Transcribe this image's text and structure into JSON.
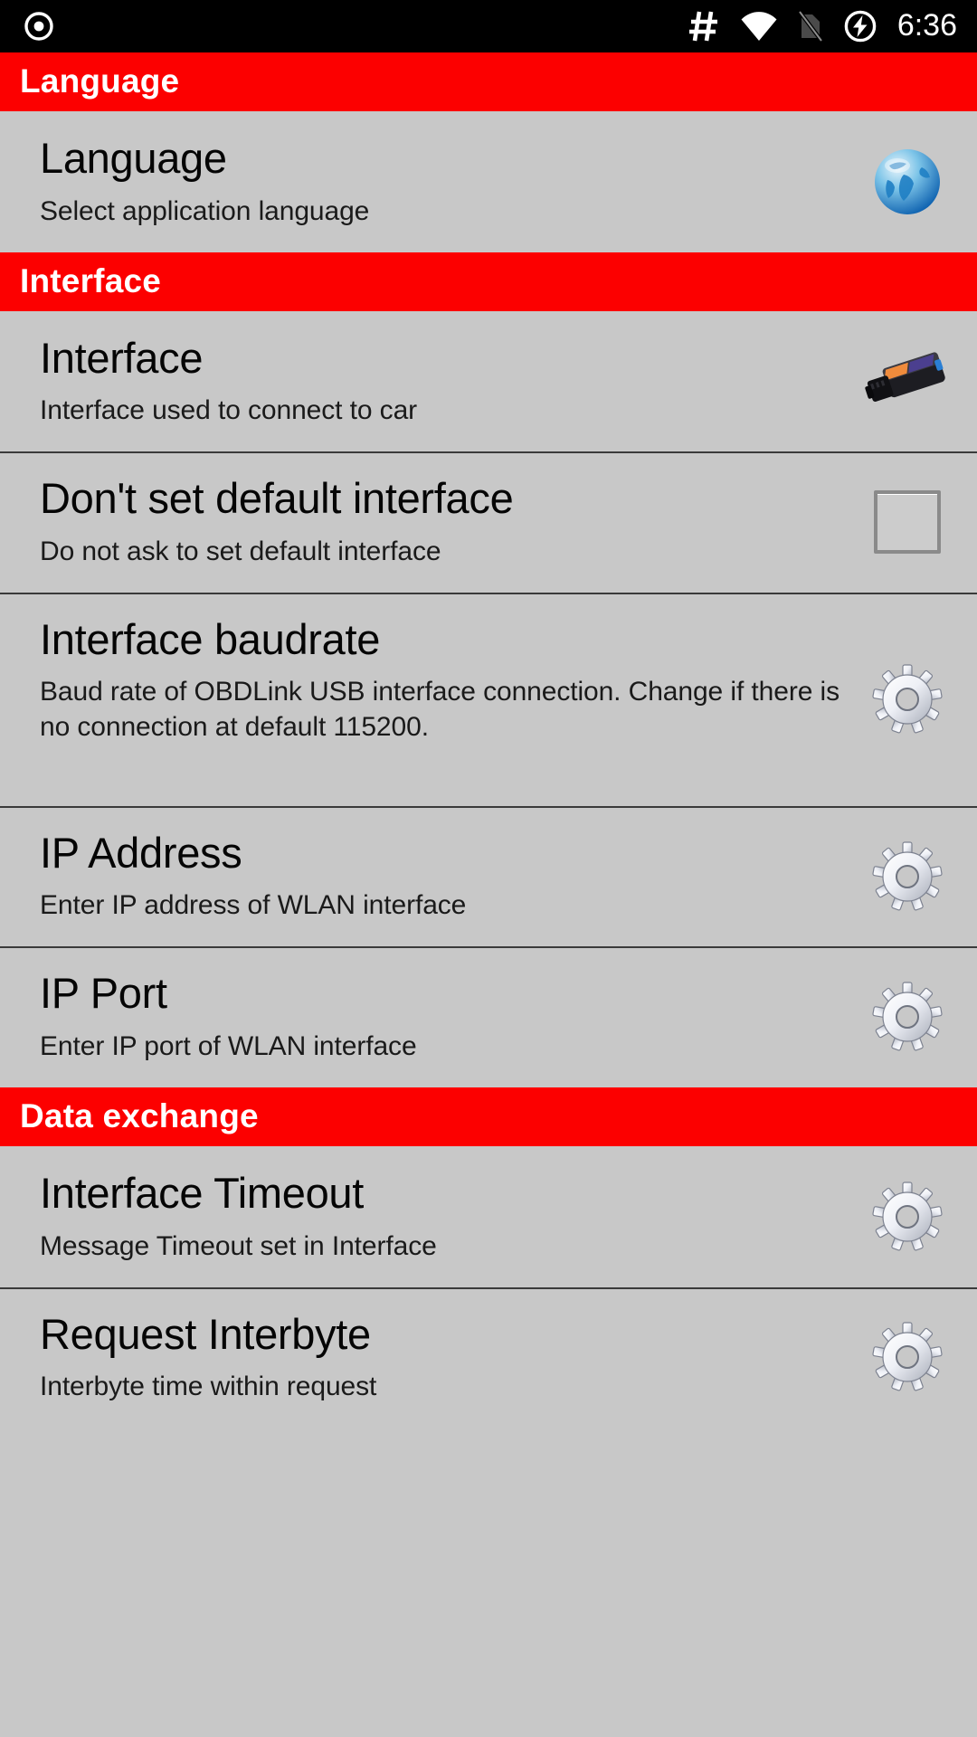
{
  "status_bar": {
    "icons": [
      "record-circle-icon",
      "hash-icon",
      "wifi-icon",
      "sim-off-icon",
      "charging-bolt-icon"
    ],
    "time": "6:36",
    "background_color": "#000000",
    "foreground_color": "#ffffff"
  },
  "theme": {
    "accent_red": "#fc0000",
    "list_background": "#c8c8c8",
    "divider": "#3a3a3a",
    "title_text": "#050505",
    "summary_text": "#1a1a1a"
  },
  "sections": [
    {
      "header": "Language",
      "rows": [
        {
          "title": "Language",
          "summary": "Select application language",
          "widget": "globe-icon",
          "divider_top": false
        }
      ]
    },
    {
      "header": "Interface",
      "rows": [
        {
          "title": "Interface",
          "summary": "Interface used to connect to car",
          "widget": "obd-dongle-icon",
          "divider_top": false
        },
        {
          "title": "Don't set default interface",
          "summary": "Do not ask to set default interface",
          "widget": "checkbox",
          "checked": false,
          "divider_top": true
        },
        {
          "title": "Interface baudrate",
          "summary": "Baud rate of OBDLink USB interface connection. Change if there is no connection at default 115200.",
          "widget": "gear-icon",
          "divider_top": true
        },
        {
          "title": "IP Address",
          "summary": "Enter IP address of WLAN interface",
          "widget": "gear-icon",
          "divider_top": true
        },
        {
          "title": "IP Port",
          "summary": "Enter IP port of WLAN interface",
          "widget": "gear-icon",
          "divider_top": true
        }
      ]
    },
    {
      "header": "Data exchange",
      "rows": [
        {
          "title": "Interface Timeout",
          "summary": "Message Timeout set in Interface",
          "widget": "gear-icon",
          "divider_top": false
        },
        {
          "title": "Request Interbyte",
          "summary": "Interbyte time within request",
          "widget": "gear-icon",
          "divider_top": true
        }
      ]
    }
  ]
}
